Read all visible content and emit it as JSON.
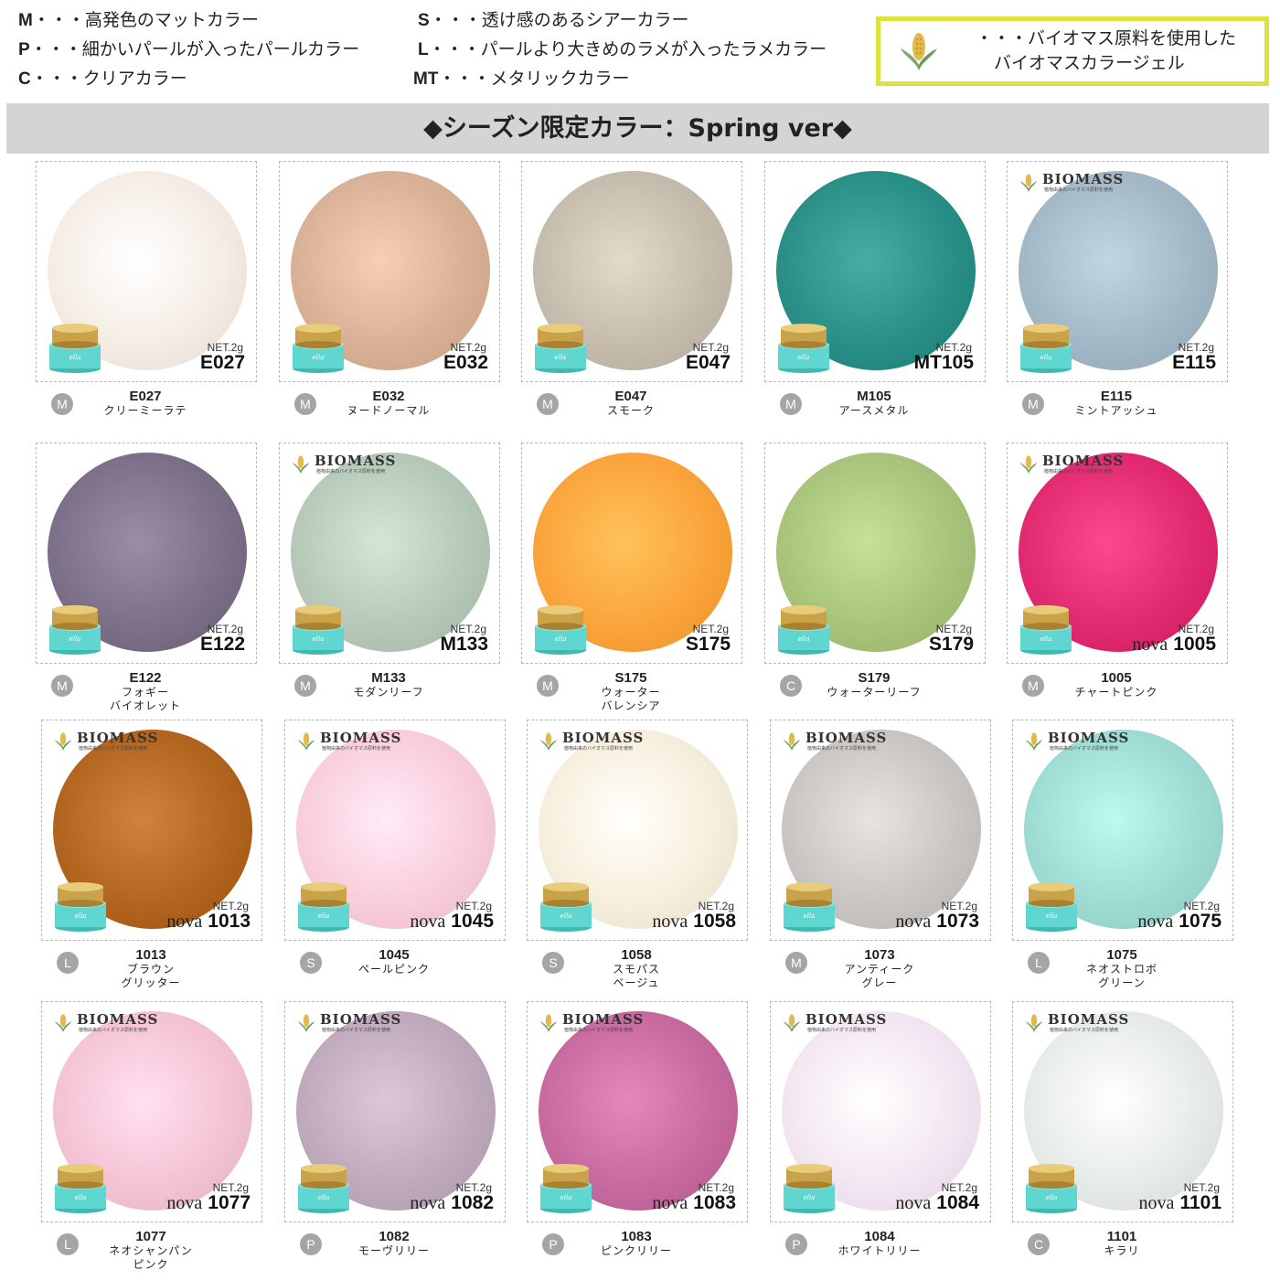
{
  "legend": {
    "m": {
      "key": "M",
      "text": "・・・高発色のマットカラー"
    },
    "p": {
      "key": "P",
      "text": "・・・細かいパールが入ったパールカラー"
    },
    "c": {
      "key": "C",
      "text": "・・・クリアカラー"
    },
    "s": {
      "key": "S",
      "text": "・・・透け感のあるシアーカラー"
    },
    "l": {
      "key": "L",
      "text": "・・・パールより大きめのラメが入ったラメカラー"
    },
    "mt": {
      "key": "MT",
      "text": "・・・メタリックカラー"
    },
    "biomass_line1": "・・・バイオマス原料を使用した",
    "biomass_line2": "バイオマスカラージェル"
  },
  "banner": "◆シーズン限定カラー：Spring ver◆",
  "biomass_logo": {
    "word": "BIOMASS",
    "sub": "植物由来のバイオマス原料を使用"
  },
  "net_label": "NET.2g",
  "nova_label": "nova",
  "colors": {
    "badge": "#a5a5a5",
    "banner": "#d4d4d4",
    "biomass_border": "#dfe23c",
    "jar_lid": "#c9a24a",
    "jar_body": "#5fd6cf"
  },
  "items": [
    {
      "code": "E027",
      "type": "M",
      "name1": "クリーミーラテ",
      "name2": "",
      "biomass": false,
      "nova": false,
      "color": "#f5ede5"
    },
    {
      "code": "E032",
      "type": "M",
      "name1": "ヌードノーマル",
      "name2": "",
      "biomass": false,
      "nova": false,
      "color": "#d9b197"
    },
    {
      "code": "E047",
      "type": "M",
      "name1": "スモーク",
      "name2": "",
      "biomass": false,
      "nova": false,
      "color": "#c5bcae"
    },
    {
      "code": "MT105",
      "type": "M",
      "caption_code": "M105",
      "name1": "アースメタル",
      "name2": "",
      "biomass": false,
      "nova": false,
      "color": "#2a8f86"
    },
    {
      "code": "E115",
      "type": "M",
      "name1": "ミントアッシュ",
      "name2": "",
      "biomass": true,
      "nova": false,
      "color": "#a3b8c6"
    },
    {
      "code": "E122",
      "type": "M",
      "name1": "フォギー",
      "name2": "バイオレット",
      "biomass": false,
      "nova": false,
      "color": "#7c7089"
    },
    {
      "code": "M133",
      "type": "M",
      "name1": "モダンリーフ",
      "name2": "",
      "biomass": true,
      "nova": false,
      "color": "#b6c8b8"
    },
    {
      "code": "S175",
      "type": "M",
      "name1": "ウォーター",
      "name2": "バレンシア",
      "biomass": false,
      "nova": false,
      "color": "#fba43c"
    },
    {
      "code": "S179",
      "type": "C",
      "name1": "ウォーターリーフ",
      "name2": "",
      "biomass": false,
      "nova": false,
      "color": "#a8c47a"
    },
    {
      "code": "1005",
      "type": "M",
      "name1": "チャートピンク",
      "name2": "",
      "biomass": true,
      "nova": true,
      "color": "#e12a6f"
    },
    {
      "code": "1013",
      "type": "L",
      "name1": "ブラウン",
      "name2": "グリッター",
      "biomass": true,
      "nova": true,
      "color": "#b2651f"
    },
    {
      "code": "1045",
      "type": "S",
      "name1": "ペールピンク",
      "name2": "",
      "biomass": true,
      "nova": true,
      "color": "#f9cddb"
    },
    {
      "code": "1058",
      "type": "S",
      "name1": "スモパス",
      "name2": "ベージュ",
      "biomass": true,
      "nova": true,
      "color": "#f7efdd"
    },
    {
      "code": "1073",
      "type": "M",
      "name1": "アンティーク",
      "name2": "グレー",
      "biomass": true,
      "nova": true,
      "color": "#c9c5c2"
    },
    {
      "code": "1075",
      "type": "L",
      "name1": "ネオストロボ",
      "name2": "グリーン",
      "biomass": true,
      "nova": true,
      "color": "#9edcd3"
    },
    {
      "code": "1077",
      "type": "L",
      "name1": "ネオシャンパン",
      "name2": "ピンク",
      "biomass": true,
      "nova": true,
      "color": "#f4c3d4"
    },
    {
      "code": "1082",
      "type": "P",
      "name1": "モーヴリリー",
      "name2": "",
      "biomass": true,
      "nova": true,
      "color": "#bfa9bd"
    },
    {
      "code": "1083",
      "type": "P",
      "name1": "ピンクリリー",
      "name2": "",
      "biomass": true,
      "nova": true,
      "color": "#c66a9f"
    },
    {
      "code": "1084",
      "type": "P",
      "name1": "ホワイトリリー",
      "name2": "",
      "biomass": true,
      "nova": true,
      "color": "#f3e6f2"
    },
    {
      "code": "1101",
      "type": "C",
      "name1": "キラリ",
      "name2": "",
      "biomass": true,
      "nova": true,
      "color": "#e6ebe9"
    }
  ]
}
